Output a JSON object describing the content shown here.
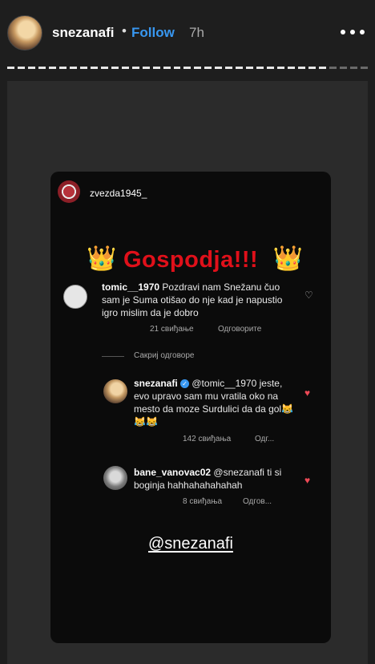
{
  "header": {
    "username": "snezanafi",
    "separator": "•",
    "follow_label": "Follow",
    "time_ago": "7h"
  },
  "progress": {
    "segments_total": 35,
    "segments_seen": 31
  },
  "story": {
    "card_username": "zvezda1945_",
    "banner_text": "Gospodja!!!",
    "crown_emoji": "👑",
    "comments": [
      {
        "username": "tomic__1970",
        "text": "Pozdravi nam Snežanu čuo sam je Suma otišao do nje kad je napustio igro mislim da je dobro",
        "likes": "21 свиђање",
        "reply_label": "Одговорите",
        "liked": false
      },
      {
        "username": "snezanafi",
        "verified": true,
        "text": "@tomic__1970 jeste, evo upravo sam mu vratila oko na mesto da moze Surdulici da da gol😹😹😹",
        "likes": "142 свиђања",
        "reply_label": "Одг...",
        "liked": true
      },
      {
        "username": "bane_vanovac02",
        "text": "@snezanafi ti si boginja hahhahahahahah",
        "likes": "8 свиђања",
        "reply_label": "Одгов...",
        "liked": true
      }
    ],
    "hide_replies_label": "Сакриј одговоре",
    "mention_sticker": "@snezanafi"
  },
  "colors": {
    "accent": "#3897f0",
    "banner_red": "#e0101a",
    "heart_red": "#ed4956"
  }
}
